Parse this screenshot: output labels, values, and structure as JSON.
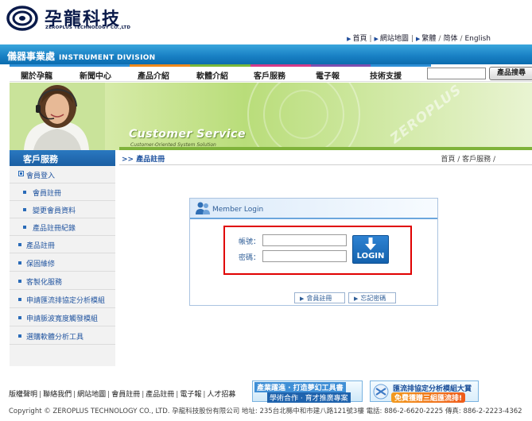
{
  "header": {
    "brand_name": "孕龍科技",
    "brand_sub": "ZEROPLUS TECHNOLOGY CO.,LTD",
    "top_links": [
      "首頁",
      "網站地圖",
      "繁體",
      "简体",
      "English"
    ]
  },
  "division": {
    "title": "儀器事業處",
    "title_en": "INSTRUMENT DIVISION"
  },
  "stripe_colors": [
    "#2e8fd6",
    "#2e8fd6",
    "#f08a1c",
    "#79b83a",
    "#d43a8a",
    "#7e4fb0",
    "#2e8fd6"
  ],
  "nav": {
    "items": [
      "關於孕龍",
      "新聞中心",
      "產品介紹",
      "軟體介紹",
      "客戶服務",
      "電子報",
      "技術支援"
    ],
    "search_value": "",
    "search_button": "產品搜尋"
  },
  "banner": {
    "title": "Customer Service",
    "subtitle": "Customer-Oriented System Solution",
    "watermark": "ZEROPLUS"
  },
  "sidebar": {
    "title": "客戶服務",
    "items": [
      {
        "label": "會員登入",
        "level": "main",
        "expanded": true
      },
      {
        "label": "會員註冊",
        "level": "sub"
      },
      {
        "label": "變更會員資料",
        "level": "sub"
      },
      {
        "label": "產品註冊紀錄",
        "level": "sub"
      },
      {
        "label": "產品註冊",
        "level": "main"
      },
      {
        "label": "保固維修",
        "level": "main"
      },
      {
        "label": "客製化服務",
        "level": "main"
      },
      {
        "label": "申請匯流排協定分析模組",
        "level": "main"
      },
      {
        "label": "申請脈波寬度觸發模組",
        "level": "main"
      },
      {
        "label": "選購軟體分析工具",
        "level": "main"
      }
    ]
  },
  "section": {
    "title": ">> 產品註冊",
    "breadcrumb": "首頁 / 客戶服務 /"
  },
  "login": {
    "title": "Member Login",
    "account_label": "帳號：",
    "account_value": "",
    "password_label": "密碼：",
    "password_value": "",
    "button_label": "LOGIN",
    "register_label": "會員註冊",
    "forgot_label": "忘記密碼"
  },
  "footer": {
    "links": [
      "版權聲明",
      "聯絡我們",
      "網站地圖",
      "會員註冊",
      "產品註冊",
      "電子報",
      "人才招募"
    ],
    "ad1_line1": "產業躍進 · 打造夢幻工具書",
    "ad1_line2": "學術合作 · 育才推廣專案",
    "ad2_line1": "匯流排協定分析模組大賞",
    "ad2_line2": "免費獲贈三組匯流排!",
    "copyright": "Copyright © ZEROPLUS TECHNOLOGY CO., LTD. 孕龍科技股份有限公司   地址: 235台北縣中和市建八路121號3樓   電話: 886-2-6620-2225   傳真: 886-2-2223-4362"
  }
}
